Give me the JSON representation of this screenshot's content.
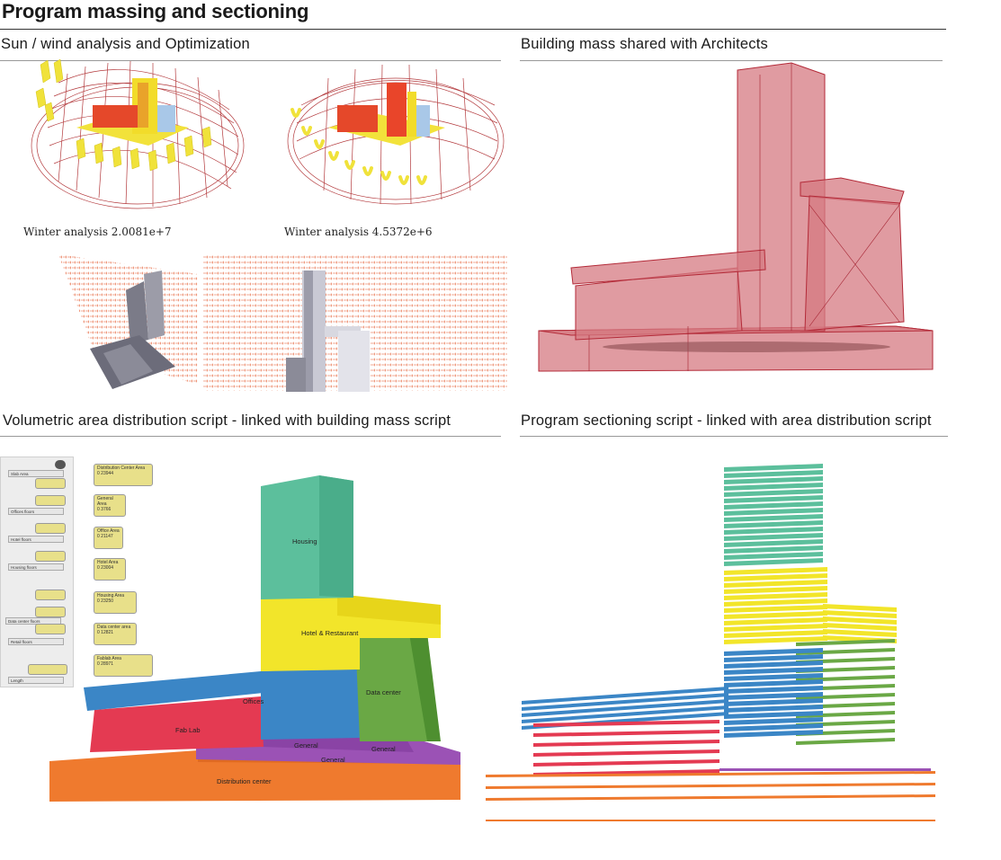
{
  "page": {
    "title": "Program massing and sectioning"
  },
  "sections": {
    "sun_wind": "Sun / wind analysis and Optimization",
    "building_mass": "Building mass shared with Architects",
    "volumetric": "Volumetric area distribution script - linked with building mass script",
    "sectioning": "Program sectioning script - linked with area distribution script"
  },
  "sun_analysis": {
    "caption_left": "Winter analysis 2.0081e+7",
    "caption_right": "Winter analysis 4.5372e+6"
  },
  "volumetric_labels": {
    "housing": "Housing",
    "hotel": "Hotel & Restaurant",
    "offices": "Offices",
    "data_center": "Data center",
    "fab_lab": "Fab Lab",
    "general_1": "General",
    "general_2": "General",
    "general_3": "General",
    "distribution": "Distribution center"
  },
  "script_nodes": {
    "area_nodes": [
      {
        "title": "Distribution Center Area",
        "value": "0 23944"
      },
      {
        "title": "General Area",
        "value": "0 3766"
      },
      {
        "title": "Office Area",
        "value": "0 21147"
      },
      {
        "title": "Hotel Area",
        "value": "0 23004"
      },
      {
        "title": "Housing Area",
        "value": "0 23250"
      },
      {
        "title": "Data center area",
        "value": "0 12821"
      },
      {
        "title": "Fablab Area",
        "value": "0 28971"
      }
    ],
    "param_nodes": [
      {
        "title": "Slab Area"
      },
      {
        "title": "Offices floors"
      },
      {
        "title": "Hotel floors"
      },
      {
        "title": "Housing floors"
      },
      {
        "title": "Data center floors"
      },
      {
        "title": "Retail floors"
      },
      {
        "title": "Length"
      }
    ]
  },
  "colors": {
    "housing": "#5cbf9c",
    "hotel": "#f2e52a",
    "offices": "#3b86c6",
    "data_center": "#6aa845",
    "fab_lab": "#e43a52",
    "general": "#9b52b5",
    "distribution": "#ef7a2e",
    "mass": "#d9898c"
  }
}
